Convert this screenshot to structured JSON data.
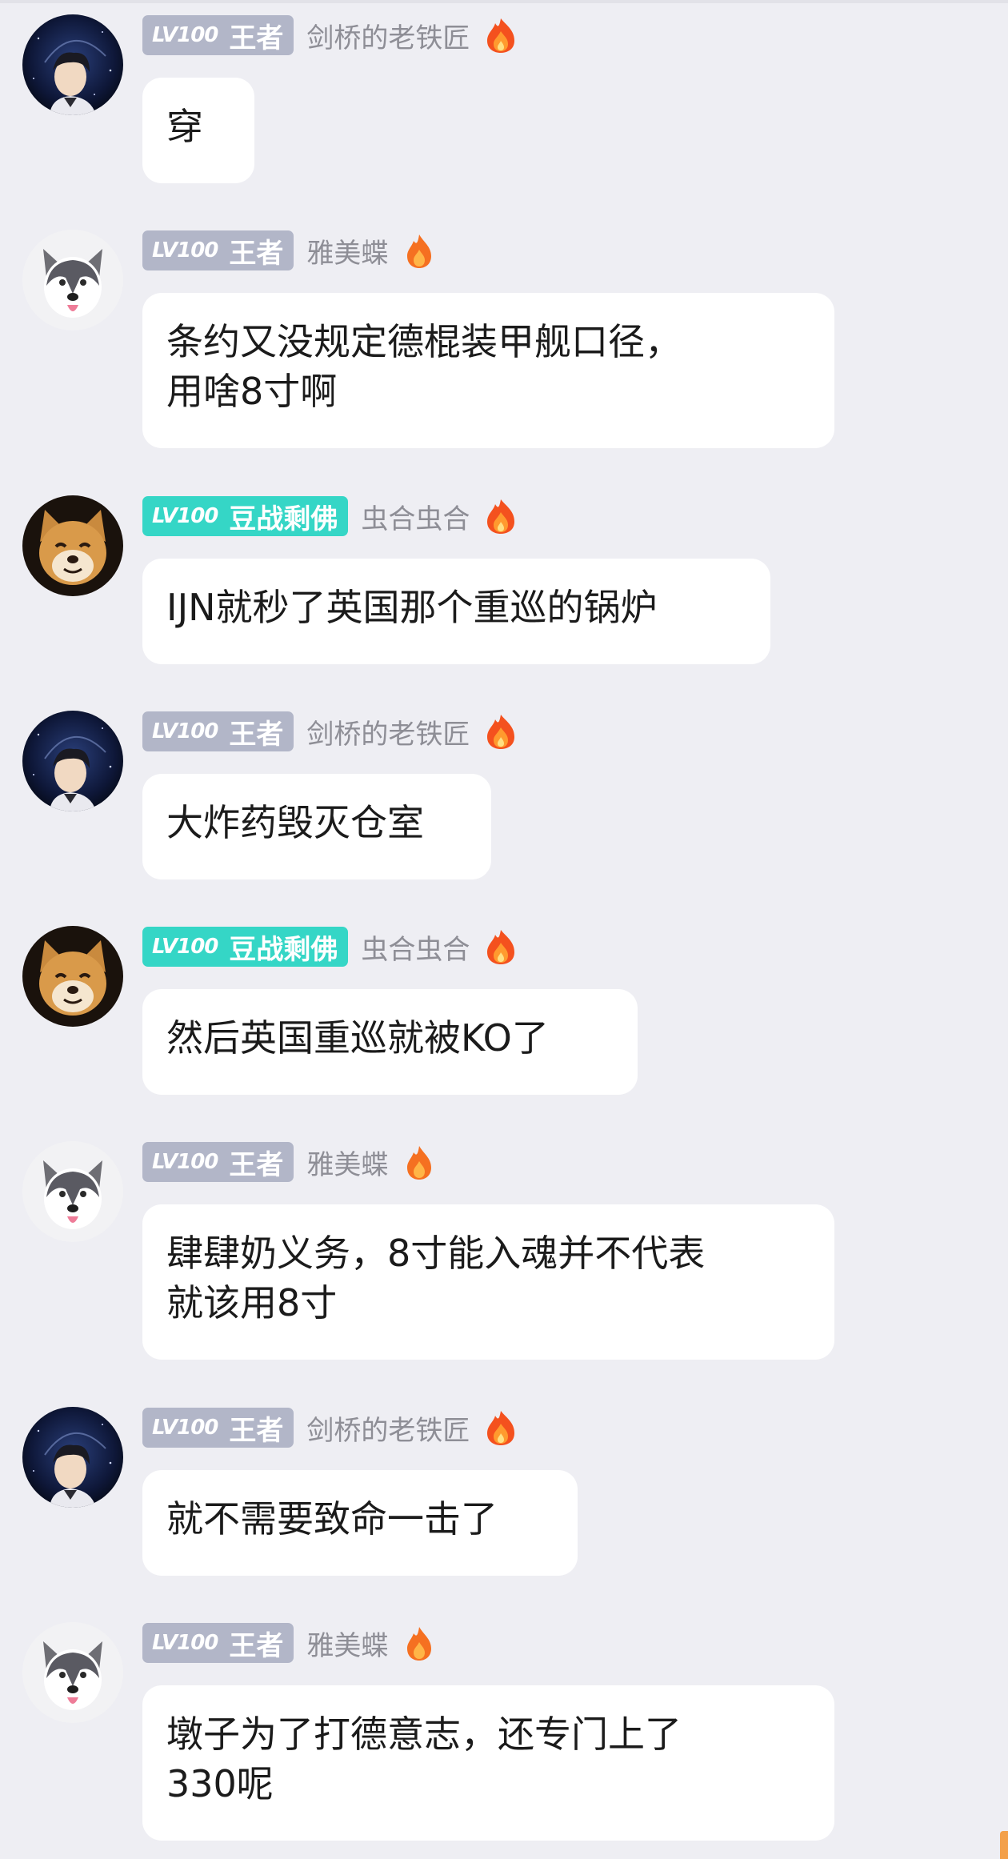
{
  "messages": [
    {
      "avatar": "astronaut-avatar",
      "badge": {
        "level": "LV100",
        "title": "王者",
        "color": "#b2b6c8"
      },
      "username": "剑桥的老铁匠",
      "flame": "flame-large-icon",
      "lines": [
        "穿"
      ]
    },
    {
      "avatar": "husky-avatar",
      "badge": {
        "level": "LV100",
        "title": "王者",
        "color": "#b2b6c8"
      },
      "username": "雅美蝶",
      "flame": "flame-small-icon",
      "lines": [
        "条约又没规定德棍装甲舰口径，",
        "用啥8寸啊"
      ]
    },
    {
      "avatar": "shiba-avatar",
      "badge": {
        "level": "LV100",
        "title": "豆战剩佛",
        "color": "#35d6c6"
      },
      "username": "虫合虫合",
      "flame": "flame-large-icon",
      "lines": [
        "IJN就秒了英国那个重巡的锅炉"
      ]
    },
    {
      "avatar": "astronaut-avatar",
      "badge": {
        "level": "LV100",
        "title": "王者",
        "color": "#b2b6c8"
      },
      "username": "剑桥的老铁匠",
      "flame": "flame-large-icon",
      "lines": [
        "大炸药毁灭仓室"
      ]
    },
    {
      "avatar": "shiba-avatar",
      "badge": {
        "level": "LV100",
        "title": "豆战剩佛",
        "color": "#35d6c6"
      },
      "username": "虫合虫合",
      "flame": "flame-large-icon",
      "lines": [
        "然后英国重巡就被KO了"
      ]
    },
    {
      "avatar": "husky-avatar",
      "badge": {
        "level": "LV100",
        "title": "王者",
        "color": "#b2b6c8"
      },
      "username": "雅美蝶",
      "flame": "flame-small-icon",
      "lines": [
        "肆肆奶义务，8寸能入魂并不代表",
        "就该用8寸"
      ]
    },
    {
      "avatar": "astronaut-avatar",
      "badge": {
        "level": "LV100",
        "title": "王者",
        "color": "#b2b6c8"
      },
      "username": "剑桥的老铁匠",
      "flame": "flame-large-icon",
      "lines": [
        "就不需要致命一击了"
      ]
    },
    {
      "avatar": "husky-avatar",
      "badge": {
        "level": "LV100",
        "title": "王者",
        "color": "#b2b6c8"
      },
      "username": "雅美蝶",
      "flame": "flame-small-icon",
      "lines": [
        "墩子为了打德意志，还专门上了",
        "330呢"
      ]
    }
  ],
  "colors": {
    "background": "#eeeef3",
    "bubble": "#ffffff",
    "username": "#8e8e96",
    "text": "#1b1b1b",
    "scroll_accent": "#f3a04a"
  }
}
